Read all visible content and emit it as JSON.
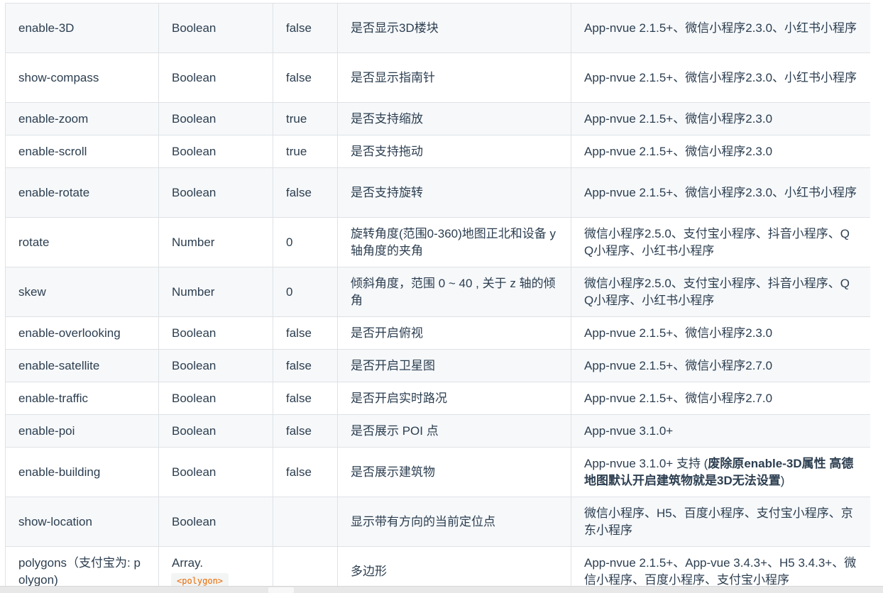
{
  "rows": [
    {
      "name": "enable-3D",
      "type": "Boolean",
      "default": "false",
      "desc": "是否显示3D楼块",
      "platform": "App-nvue 2.1.5+、微信小程序2.3.0、小红书小程序"
    },
    {
      "name": "show-compass",
      "type": "Boolean",
      "default": "false",
      "desc": "是否显示指南针",
      "platform": "App-nvue 2.1.5+、微信小程序2.3.0、小红书小程序"
    },
    {
      "name": "enable-zoom",
      "type": "Boolean",
      "default": "true",
      "desc": "是否支持缩放",
      "platform": "App-nvue 2.1.5+、微信小程序2.3.0"
    },
    {
      "name": "enable-scroll",
      "type": "Boolean",
      "default": "true",
      "desc": "是否支持拖动",
      "platform": "App-nvue 2.1.5+、微信小程序2.3.0"
    },
    {
      "name": "enable-rotate",
      "type": "Boolean",
      "default": "false",
      "desc": "是否支持旋转",
      "platform": "App-nvue 2.1.5+、微信小程序2.3.0、小红书小程序"
    },
    {
      "name": "rotate",
      "type": "Number",
      "default": "0",
      "desc": "旋转角度(范围0-360)地图正北和设备 y 轴角度的夹角",
      "platform": "微信小程序2.5.0、支付宝小程序、抖音小程序、QQ小程序、小红书小程序"
    },
    {
      "name": "skew",
      "type": "Number",
      "default": "0",
      "desc": "倾斜角度，范围 0 ~ 40 , 关于 z 轴的倾角",
      "platform": "微信小程序2.5.0、支付宝小程序、抖音小程序、QQ小程序、小红书小程序"
    },
    {
      "name": "enable-overlooking",
      "type": "Boolean",
      "default": "false",
      "desc": "是否开启俯视",
      "platform": "App-nvue 2.1.5+、微信小程序2.3.0"
    },
    {
      "name": "enable-satellite",
      "type": "Boolean",
      "default": "false",
      "desc": "是否开启卫星图",
      "platform": "App-nvue 2.1.5+、微信小程序2.7.0"
    },
    {
      "name": "enable-traffic",
      "type": "Boolean",
      "default": "false",
      "desc": "是否开启实时路况",
      "platform": "App-nvue 2.1.5+、微信小程序2.7.0"
    },
    {
      "name": "enable-poi",
      "type": "Boolean",
      "default": "false",
      "desc": "是否展示 POI 点",
      "platform": "App-nvue 3.1.0+"
    },
    {
      "name": "enable-building",
      "type": "Boolean",
      "default": "false",
      "desc": "是否展示建筑物",
      "platform_pre": "App-nvue 3.1.0+ 支持 (",
      "platform_bold": "废除原enable-3D属性 高德地图默认开启建筑物就是3D无法设置",
      "platform_post": ")"
    },
    {
      "name": "show-location",
      "type": "Boolean",
      "default": "",
      "desc": "显示带有方向的当前定位点",
      "platform": "微信小程序、H5、百度小程序、支付宝小程序、京东小程序"
    },
    {
      "name": "polygons（支付宝为: polygon)",
      "type": "Array.",
      "type_code": "<polygon>",
      "default": "",
      "desc": "多边形",
      "platform": "App-nvue 2.1.5+、App-vue 3.4.3+、H5 3.4.3+、微信小程序、百度小程序、支付宝小程序"
    }
  ]
}
